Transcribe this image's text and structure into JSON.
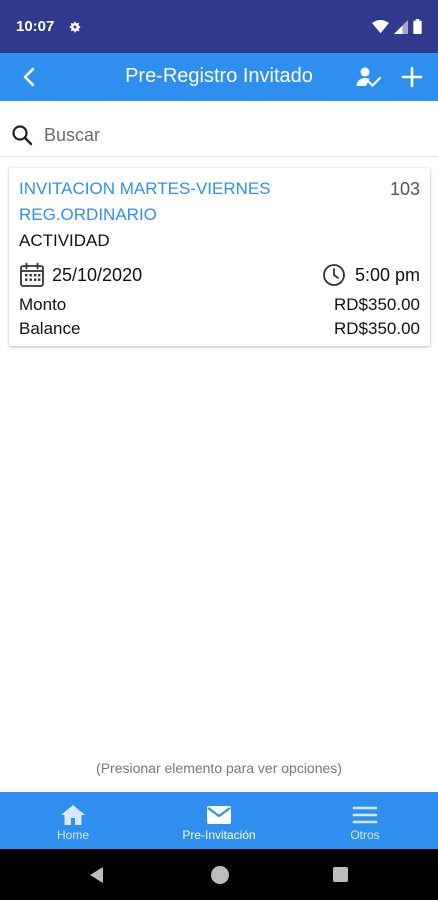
{
  "status_bar": {
    "time": "10:07",
    "icons": [
      "gear-icon",
      "wifi-icon",
      "signal-icon",
      "battery-icon"
    ]
  },
  "app_bar": {
    "title": "Pre-Registro Invitado",
    "back_icon": "arrow-back-icon",
    "actions": [
      "user-check-icon",
      "add-icon"
    ]
  },
  "search": {
    "placeholder": "Buscar",
    "value": ""
  },
  "items": [
    {
      "title": "INVITACION MARTES-VIERNES REG.ORDINARIO",
      "number": "103",
      "category": "ACTIVIDAD",
      "date": "25/10/2020",
      "time": "5:00 pm",
      "amount_label": "Monto",
      "amount_value": "RD$350.00",
      "balance_label": "Balance",
      "balance_value": "RD$350.00"
    }
  ],
  "hint": "(Presionar elemento para ver opciones)",
  "bottom_nav": [
    {
      "label": "Home",
      "icon": "home-icon",
      "active": false
    },
    {
      "label": "Pre-Invitación",
      "icon": "mail-icon",
      "active": true
    },
    {
      "label": "Otros",
      "icon": "menu-icon",
      "active": false
    }
  ],
  "colors": {
    "status_bar": "#2f3a8c",
    "primary": "#2f8fef",
    "title_text": "#2f8fef"
  }
}
